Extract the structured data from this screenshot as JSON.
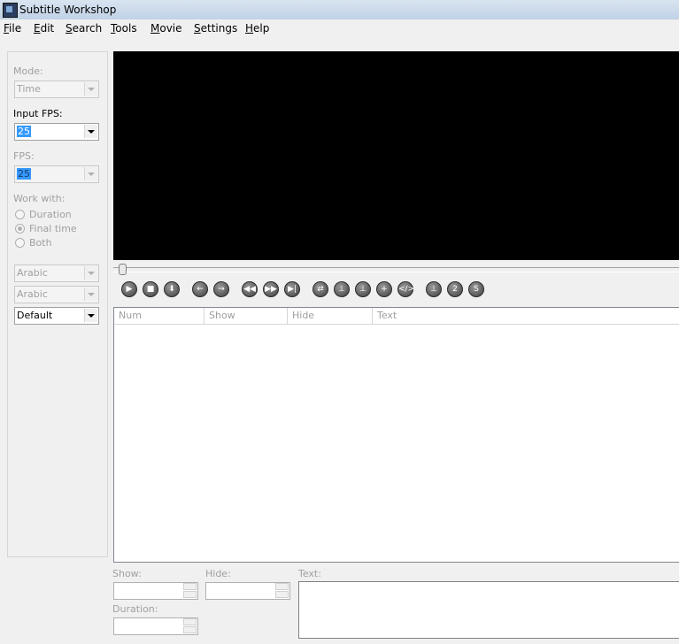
{
  "window": {
    "title": "Subtitle Workshop"
  },
  "menu": [
    {
      "label": "File",
      "accel": "F",
      "rest": "ile"
    },
    {
      "label": "Edit",
      "accel": "E",
      "rest": "dit"
    },
    {
      "label": "Search",
      "accel": "S",
      "rest": "earch"
    },
    {
      "label": "Tools",
      "accel": "T",
      "rest": "ools"
    },
    {
      "label": "Movie",
      "accel": "M",
      "rest": "ovie"
    },
    {
      "label": "Settings",
      "accel": "S",
      "rest": "ettings"
    },
    {
      "label": "Help",
      "accel": "H",
      "rest": "elp"
    }
  ],
  "sidebar": {
    "mode_label": "Mode:",
    "mode_value": "Time",
    "input_fps_label": "Input FPS:",
    "input_fps_value": "25",
    "fps_label": "FPS:",
    "fps_value": "25",
    "work_with_label": "Work with:",
    "work_with_options": [
      "Duration",
      "Final time",
      "Both"
    ],
    "work_with_selected": "Final time",
    "lang1": "Arabic",
    "lang2": "Arabic",
    "style": "Default"
  },
  "toolbar": {
    "buttons": [
      "play-icon",
      "stop-icon",
      "down-icon",
      "left-arrow-icon",
      "right-arrow-icon",
      "rewind-icon",
      "fast-forward-icon",
      "next-frame-icon",
      "loop-icon",
      "set-start-icon",
      "set-end-icon",
      "add-icon",
      "code-icon",
      "first-icon",
      "second-icon",
      "s-icon"
    ]
  },
  "grid": {
    "columns": [
      "Num",
      "Show",
      "Hide",
      "Text"
    ]
  },
  "bottom": {
    "show_label": "Show:",
    "hide_label": "Hide:",
    "duration_label": "Duration:",
    "text_label": "Text:"
  },
  "colors": {
    "selection": "#3399ff",
    "video": "#000000",
    "disabled_text": "#a0a0a0"
  }
}
